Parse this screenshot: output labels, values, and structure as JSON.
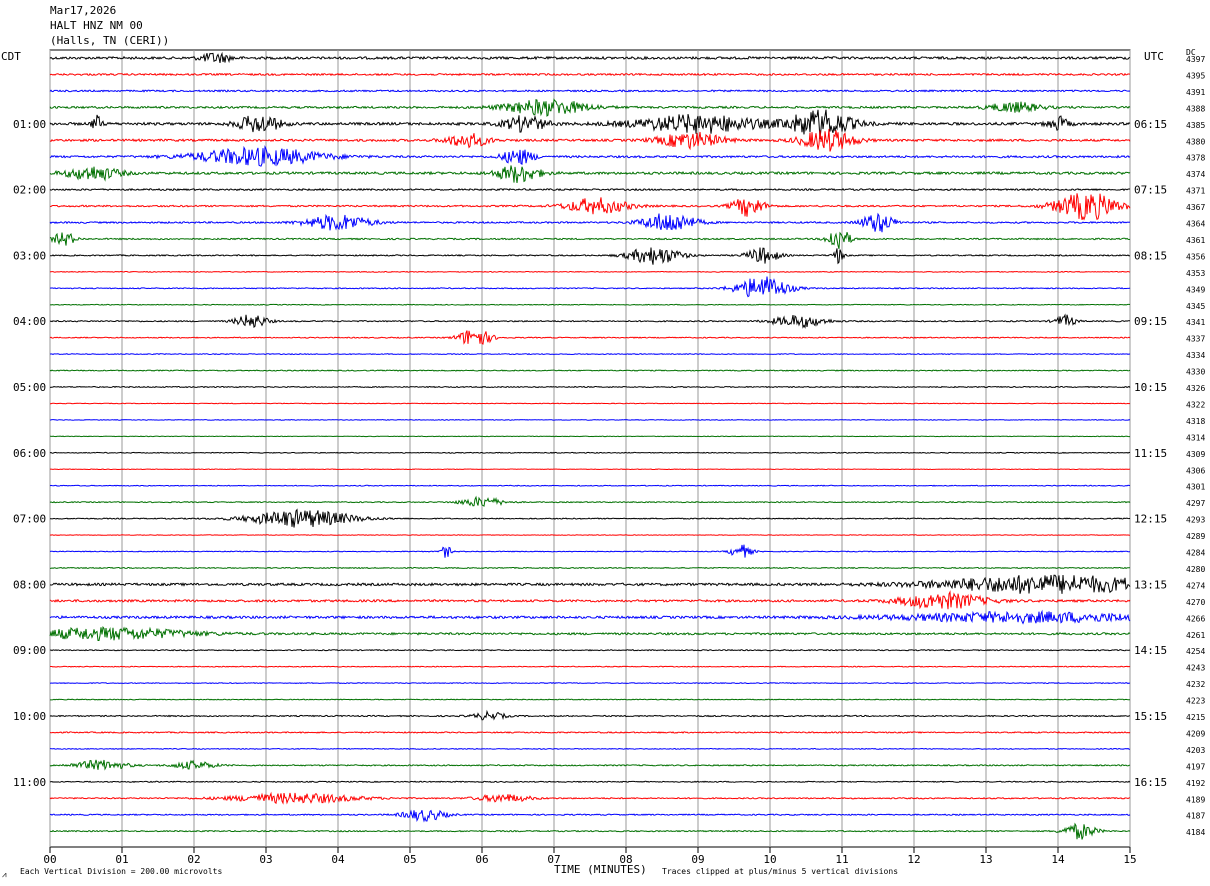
{
  "header": {
    "date": "Mar17,2026",
    "station": "HALT HNZ NM 00",
    "location": "(Halls, TN (CERI))"
  },
  "left_label": "CDT",
  "right_label": "UTC",
  "dc_label": "DC",
  "footer": {
    "scale_note": "Each Vertical Division =  200.00 microvolts",
    "xlabel": "TIME (MINUTES)",
    "clip_note": "Traces clipped at plus/minus 5 vertical divisions"
  },
  "chart_data": {
    "type": "line",
    "title": "HALT HNZ NM 00",
    "xlabel": "TIME (MINUTES)",
    "xlim": [
      0,
      15
    ],
    "x_ticks": [
      "00",
      "01",
      "02",
      "03",
      "04",
      "05",
      "06",
      "07",
      "08",
      "09",
      "10",
      "11",
      "12",
      "13",
      "14",
      "15"
    ],
    "trace_colors": [
      "#000000",
      "#ff0000",
      "#0000ff",
      "#007000"
    ],
    "cdt_hour_labels": [
      "01:00",
      "02:00",
      "03:00",
      "04:00",
      "05:00",
      "06:00",
      "07:00",
      "08:00",
      "09:00",
      "10:00",
      "11:00"
    ],
    "utc_hour_labels": [
      "06:15",
      "07:15",
      "08:15",
      "09:15",
      "10:15",
      "11:15",
      "12:15",
      "13:15",
      "14:15",
      "15:15",
      "16:15"
    ],
    "dc_values": [
      4397,
      4395,
      4391,
      4388,
      4385,
      4380,
      4378,
      4374,
      4371,
      4367,
      4364,
      4361,
      4356,
      4353,
      4349,
      4345,
      4341,
      4337,
      4334,
      4330,
      4326,
      4322,
      4318,
      4314,
      4309,
      4306,
      4301,
      4297,
      4293,
      4289,
      4284,
      4280,
      4274,
      4270,
      4266,
      4261,
      4254,
      4243,
      4232,
      4223,
      4215,
      4209,
      4203,
      4197,
      4192,
      4189,
      4187,
      4184
    ],
    "trace_noise": [
      1.2,
      0.9,
      0.8,
      1.0,
      1.3,
      1.1,
      1.0,
      1.2,
      0.8,
      0.8,
      0.8,
      0.7,
      0.6,
      0.4,
      0.5,
      0.4,
      0.6,
      0.5,
      0.4,
      0.5,
      0.5,
      0.3,
      0.3,
      0.3,
      0.4,
      0.3,
      0.4,
      0.5,
      0.5,
      0.3,
      0.4,
      0.5,
      1.2,
      1.1,
      1.2,
      1.0,
      0.5,
      0.4,
      0.4,
      0.4,
      0.6,
      0.6,
      0.4,
      0.6,
      0.5,
      0.6,
      0.6,
      0.6
    ],
    "events": [
      {
        "trace": 0,
        "minute": 2.3,
        "amp": 5,
        "dur": 0.3
      },
      {
        "trace": 3,
        "minute": 6.9,
        "amp": 8,
        "dur": 0.8
      },
      {
        "trace": 3,
        "minute": 13.4,
        "amp": 5,
        "dur": 0.5
      },
      {
        "trace": 4,
        "minute": 0.65,
        "amp": 8,
        "dur": 0.1
      },
      {
        "trace": 4,
        "minute": 2.9,
        "amp": 9,
        "dur": 0.4
      },
      {
        "trace": 4,
        "minute": 6.6,
        "amp": 8,
        "dur": 0.4
      },
      {
        "trace": 4,
        "minute": 9.0,
        "amp": 9,
        "dur": 1.2
      },
      {
        "trace": 4,
        "minute": 10.7,
        "amp": 14,
        "dur": 0.6
      },
      {
        "trace": 4,
        "minute": 14.0,
        "amp": 7,
        "dur": 0.2
      },
      {
        "trace": 5,
        "minute": 5.8,
        "amp": 7,
        "dur": 0.4
      },
      {
        "trace": 5,
        "minute": 8.9,
        "amp": 8,
        "dur": 0.6
      },
      {
        "trace": 5,
        "minute": 10.8,
        "amp": 11,
        "dur": 0.5
      },
      {
        "trace": 6,
        "minute": 2.9,
        "amp": 9,
        "dur": 1.2
      },
      {
        "trace": 6,
        "minute": 6.5,
        "amp": 8,
        "dur": 0.3
      },
      {
        "trace": 7,
        "minute": 0.6,
        "amp": 7,
        "dur": 0.5
      },
      {
        "trace": 7,
        "minute": 6.5,
        "amp": 9,
        "dur": 0.4
      },
      {
        "trace": 9,
        "minute": 7.6,
        "amp": 8,
        "dur": 0.6
      },
      {
        "trace": 9,
        "minute": 9.7,
        "amp": 10,
        "dur": 0.3
      },
      {
        "trace": 9,
        "minute": 14.4,
        "amp": 14,
        "dur": 0.6
      },
      {
        "trace": 10,
        "minute": 4.0,
        "amp": 8,
        "dur": 0.6
      },
      {
        "trace": 10,
        "minute": 8.6,
        "amp": 10,
        "dur": 0.5
      },
      {
        "trace": 10,
        "minute": 11.5,
        "amp": 10,
        "dur": 0.3
      },
      {
        "trace": 11,
        "minute": 0.2,
        "amp": 7,
        "dur": 0.2
      },
      {
        "trace": 11,
        "minute": 10.95,
        "amp": 13,
        "dur": 0.2
      },
      {
        "trace": 12,
        "minute": 8.4,
        "amp": 9,
        "dur": 0.5
      },
      {
        "trace": 12,
        "minute": 9.9,
        "amp": 8,
        "dur": 0.3
      },
      {
        "trace": 12,
        "minute": 10.95,
        "amp": 8,
        "dur": 0.1
      },
      {
        "trace": 14,
        "minute": 9.9,
        "amp": 12,
        "dur": 0.5
      },
      {
        "trace": 16,
        "minute": 2.8,
        "amp": 7,
        "dur": 0.3
      },
      {
        "trace": 16,
        "minute": 10.4,
        "amp": 6,
        "dur": 0.5
      },
      {
        "trace": 16,
        "minute": 14.1,
        "amp": 6,
        "dur": 0.2
      },
      {
        "trace": 17,
        "minute": 5.9,
        "amp": 10,
        "dur": 0.3
      },
      {
        "trace": 27,
        "minute": 6.0,
        "amp": 5,
        "dur": 0.4
      },
      {
        "trace": 28,
        "minute": 3.5,
        "amp": 9,
        "dur": 1.0
      },
      {
        "trace": 30,
        "minute": 5.5,
        "amp": 6,
        "dur": 0.1
      },
      {
        "trace": 30,
        "minute": 9.6,
        "amp": 7,
        "dur": 0.2
      },
      {
        "trace": 32,
        "minute": 13.9,
        "amp": 9,
        "dur": 2.2
      },
      {
        "trace": 33,
        "minute": 12.4,
        "amp": 8,
        "dur": 0.8
      },
      {
        "trace": 34,
        "minute": 13.6,
        "amp": 5,
        "dur": 2.5
      },
      {
        "trace": 35,
        "minute": 0.8,
        "amp": 6,
        "dur": 1.6
      },
      {
        "trace": 40,
        "minute": 6.1,
        "amp": 4,
        "dur": 0.3
      },
      {
        "trace": 43,
        "minute": 0.7,
        "amp": 5,
        "dur": 0.5
      },
      {
        "trace": 43,
        "minute": 2.0,
        "amp": 4,
        "dur": 0.4
      },
      {
        "trace": 45,
        "minute": 3.4,
        "amp": 5,
        "dur": 1.2
      },
      {
        "trace": 45,
        "minute": 6.3,
        "amp": 4,
        "dur": 0.5
      },
      {
        "trace": 46,
        "minute": 5.2,
        "amp": 6,
        "dur": 0.4
      },
      {
        "trace": 47,
        "minute": 14.3,
        "amp": 8,
        "dur": 0.3
      }
    ]
  }
}
